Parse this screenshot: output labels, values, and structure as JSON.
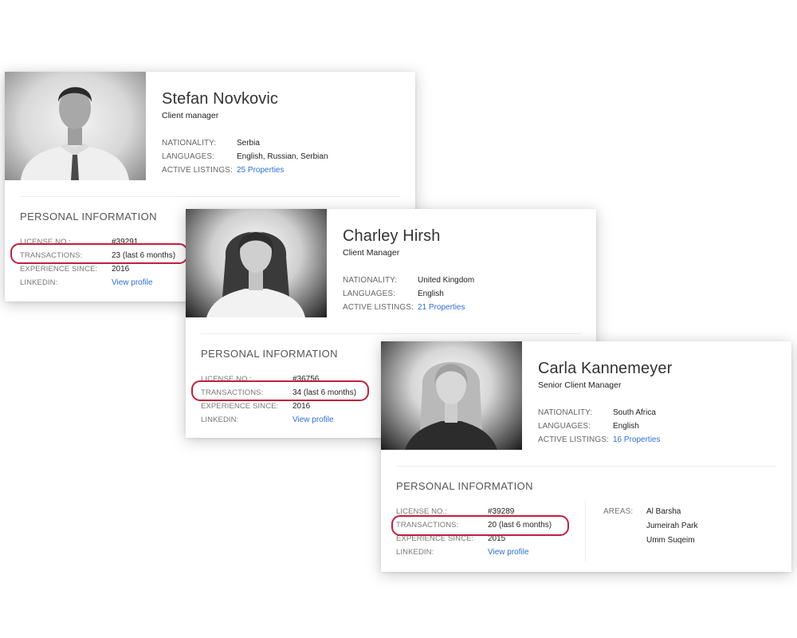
{
  "cards": [
    {
      "name": "Stefan Novkovic",
      "title": "Client manager",
      "nationality_label": "NATIONALITY:",
      "nationality": "Serbia",
      "languages_label": "LANGUAGES:",
      "languages": "English, Russian, Serbian",
      "listings_label": "ACTIVE LISTINGS:",
      "listings": "25 Properties",
      "section_title": "PERSONAL INFORMATION",
      "license_label": "LICENSE NO.:",
      "license": "#39291",
      "transactions_label": "TRANSACTIONS:",
      "transactions": "23  (last 6 months)",
      "experience_label": "EXPERIENCE SINCE:",
      "experience": "2016",
      "linkedin_label": "LINKEDIN:",
      "linkedin": "View profile"
    },
    {
      "name": "Charley Hirsh",
      "title": "Client Manager",
      "nationality_label": "NATIONALITY:",
      "nationality": "United Kingdom",
      "languages_label": "LANGUAGES:",
      "languages": "English",
      "listings_label": "ACTIVE LISTINGS:",
      "listings": "21 Properties",
      "section_title": "PERSONAL INFORMATION",
      "license_label": "LICENSE NO.:",
      "license": "#36756",
      "transactions_label": "TRANSACTIONS:",
      "transactions": "34  (last 6 months)",
      "experience_label": "EXPERIENCE SINCE:",
      "experience": "2016",
      "linkedin_label": "LINKEDIN:",
      "linkedin": "View profile"
    },
    {
      "name": "Carla Kannemeyer",
      "title": "Senior Client Manager",
      "nationality_label": "NATIONALITY:",
      "nationality": "South Africa",
      "languages_label": "LANGUAGES:",
      "languages": "English",
      "listings_label": "ACTIVE LISTINGS:",
      "listings": "16 Properties",
      "section_title": "PERSONAL INFORMATION",
      "license_label": "LICENSE NO.:",
      "license": "#39289",
      "transactions_label": "TRANSACTIONS:",
      "transactions": "20  (last 6 months)",
      "experience_label": "EXPERIENCE SINCE:",
      "experience": "2015",
      "linkedin_label": "LINKEDIN:",
      "linkedin": "View profile",
      "areas_label": "AREAS:",
      "areas": [
        "Al Barsha",
        "Jumeirah Park",
        "Umm Suqeim"
      ]
    }
  ],
  "colors": {
    "link": "#2f6fd6",
    "highlight": "#c21f3c"
  }
}
